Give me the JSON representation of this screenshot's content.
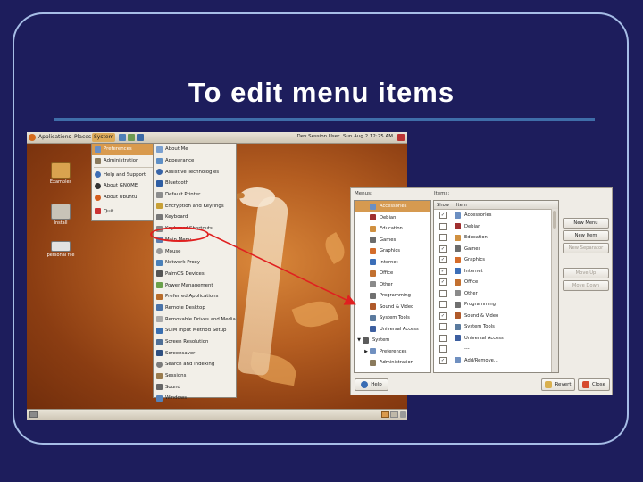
{
  "slide": {
    "title": "To edit menu items"
  },
  "colors": {
    "background": "#1d1d5c",
    "frame": "#a6bde6",
    "rule": "#3f6ea9",
    "highlight": "#d99a4d",
    "annotation": "#e02020"
  },
  "panel": {
    "menus": [
      "Applications",
      "Places",
      "System"
    ],
    "clock": "Dev Session User",
    "date": "Sun Aug 2 12:25 AM"
  },
  "desktop_icons": [
    {
      "label": "Examples",
      "icon": "folder-icon"
    },
    {
      "label": "Install",
      "icon": "installer-icon"
    },
    {
      "label": "personal file",
      "icon": "drive-icon"
    }
  ],
  "system_menu": [
    {
      "label": "Preferences",
      "icon": "preferences-icon",
      "submenu": true,
      "highlighted": true
    },
    {
      "label": "Administration",
      "icon": "admin-icon",
      "submenu": true
    },
    {
      "label": "Help and Support",
      "icon": "help-icon"
    },
    {
      "label": "About GNOME",
      "icon": "gnome-icon"
    },
    {
      "label": "About Ubuntu",
      "icon": "ubuntu-icon"
    },
    {
      "label": "Quit...",
      "icon": "quit-icon"
    }
  ],
  "preferences_menu": [
    "About Me",
    "Appearance",
    "Assistive Technologies",
    "Bluetooth",
    "Default Printer",
    "Encryption and Keyrings",
    "Keyboard",
    "Keyboard Shortcuts",
    "Main Menu",
    "Mouse",
    "Network Proxy",
    "PalmOS Devices",
    "Power Management",
    "Preferred Applications",
    "Remote Desktop",
    "Removable Drives and Media",
    "SCIM Input Method Setup",
    "Screen Resolution",
    "Screensaver",
    "Search and Indexing",
    "Sessions",
    "Sound",
    "Windows"
  ],
  "dialog": {
    "menus_label": "Menus:",
    "items_label": "Items:",
    "show_col": "Show",
    "item_col": "Item",
    "menus_tree": [
      {
        "label": "Accessories",
        "level": 1,
        "selected": true
      },
      {
        "label": "Debian",
        "level": 1
      },
      {
        "label": "Education",
        "level": 1
      },
      {
        "label": "Games",
        "level": 1
      },
      {
        "label": "Graphics",
        "level": 1
      },
      {
        "label": "Internet",
        "level": 1
      },
      {
        "label": "Office",
        "level": 1
      },
      {
        "label": "Other",
        "level": 1
      },
      {
        "label": "Programming",
        "level": 1
      },
      {
        "label": "Sound & Video",
        "level": 1
      },
      {
        "label": "System Tools",
        "level": 1
      },
      {
        "label": "Universal Access",
        "level": 1
      },
      {
        "label": "System",
        "level": 0,
        "expanded": true
      },
      {
        "label": "Preferences",
        "level": 1,
        "collapsed": true
      },
      {
        "label": "Administration",
        "level": 1
      }
    ],
    "items": [
      {
        "label": "Accessories",
        "checked": true
      },
      {
        "label": "Debian",
        "checked": false
      },
      {
        "label": "Education",
        "checked": false
      },
      {
        "label": "Games",
        "checked": true
      },
      {
        "label": "Graphics",
        "checked": true
      },
      {
        "label": "Internet",
        "checked": true
      },
      {
        "label": "Office",
        "checked": true
      },
      {
        "label": "Other",
        "checked": false
      },
      {
        "label": "Programming",
        "checked": false
      },
      {
        "label": "Sound & Video",
        "checked": true
      },
      {
        "label": "System Tools",
        "checked": false
      },
      {
        "label": "Universal Access",
        "checked": false
      },
      {
        "label": "---",
        "checked": false
      },
      {
        "label": "Add/Remove...",
        "checked": true
      }
    ],
    "buttons": {
      "new_menu": "New Menu",
      "new_item": "New Item",
      "new_separator": "New Separator",
      "move_up": "Move Up",
      "move_down": "Move Down",
      "help": "Help",
      "revert": "Revert",
      "close": "Close"
    }
  }
}
